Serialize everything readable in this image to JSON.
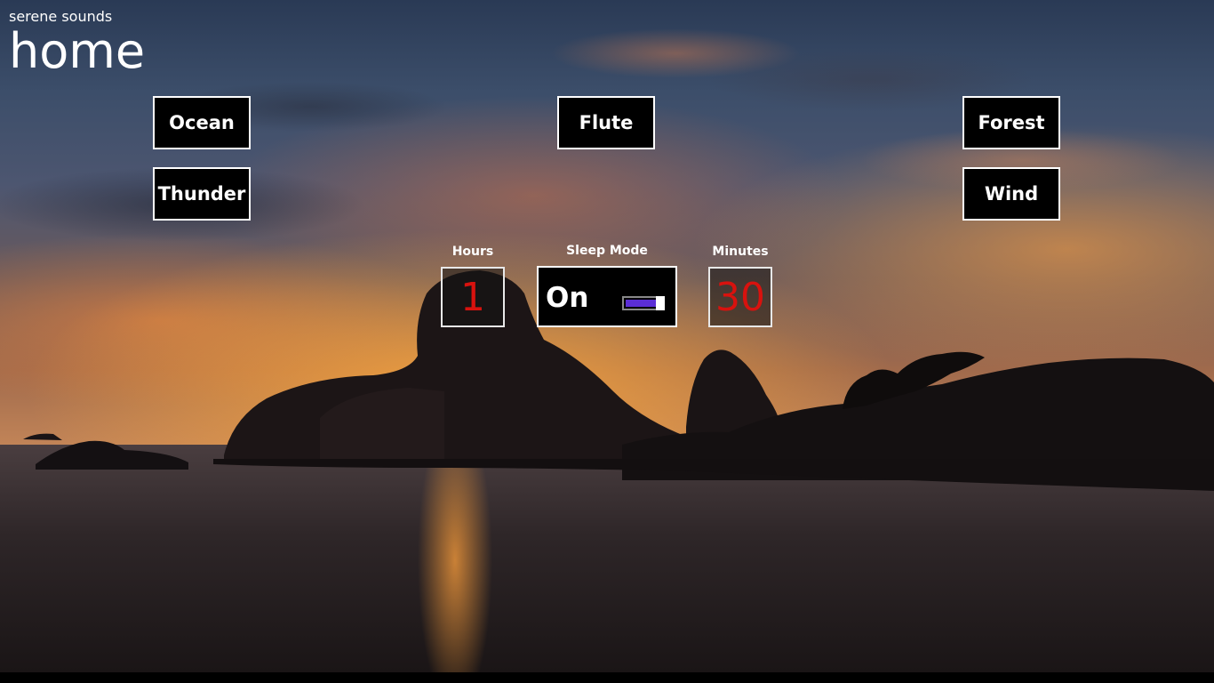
{
  "header": {
    "app_name": "serene sounds",
    "page_title": "home"
  },
  "sounds": {
    "ocean": "Ocean",
    "thunder": "Thunder",
    "flute": "Flute",
    "forest": "Forest",
    "wind": "Wind"
  },
  "timer": {
    "hours_label": "Hours",
    "hours_value": "1",
    "sleep_label": "Sleep Mode",
    "sleep_state": "On",
    "minutes_label": "Minutes",
    "minutes_value": "30",
    "sleep_on": true
  },
  "colors": {
    "timer_digits": "#d8120e",
    "toggle_accent": "#5b2ed6",
    "button_bg": "#000000",
    "button_border": "#ffffff"
  }
}
